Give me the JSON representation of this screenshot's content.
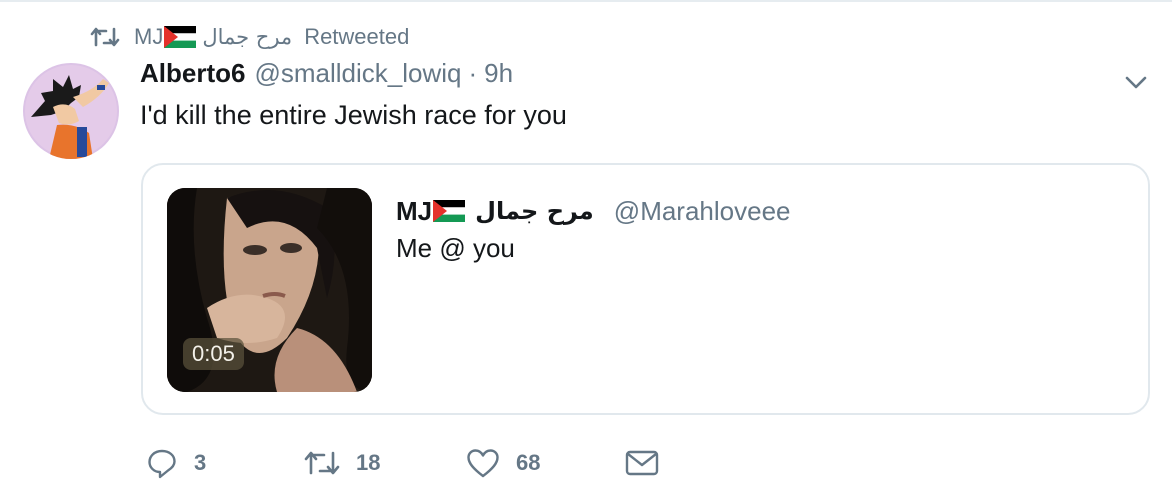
{
  "retweet_context": {
    "retweeter_name_latin": "MJ",
    "retweeter_name_arabic": "مرح جمال",
    "label": "Retweeted",
    "icon": "retweet-icon"
  },
  "tweet": {
    "display_name": "Alberto6",
    "handle": "@smalldick_lowiq",
    "separator": "·",
    "time": "9h",
    "text": "I'd kill the entire Jewish race for you",
    "menu_icon": "chevron-down-icon"
  },
  "quoted_tweet": {
    "display_name_latin": "MJ",
    "display_name_arabic": "مرح جمال",
    "handle": "@Marahloveee",
    "text": "Me @ you",
    "video_duration": "0:05"
  },
  "actions": {
    "reply_count": "3",
    "retweet_count": "18",
    "like_count": "68",
    "icons": [
      "reply-icon",
      "retweet-icon",
      "like-icon",
      "direct-message-icon"
    ]
  },
  "colors": {
    "text_primary": "#14171a",
    "text_secondary": "#657786",
    "border": "#e1e8ed",
    "flag_black": "#000000",
    "flag_white": "#ffffff",
    "flag_green": "#149954",
    "flag_red": "#e4312b"
  }
}
